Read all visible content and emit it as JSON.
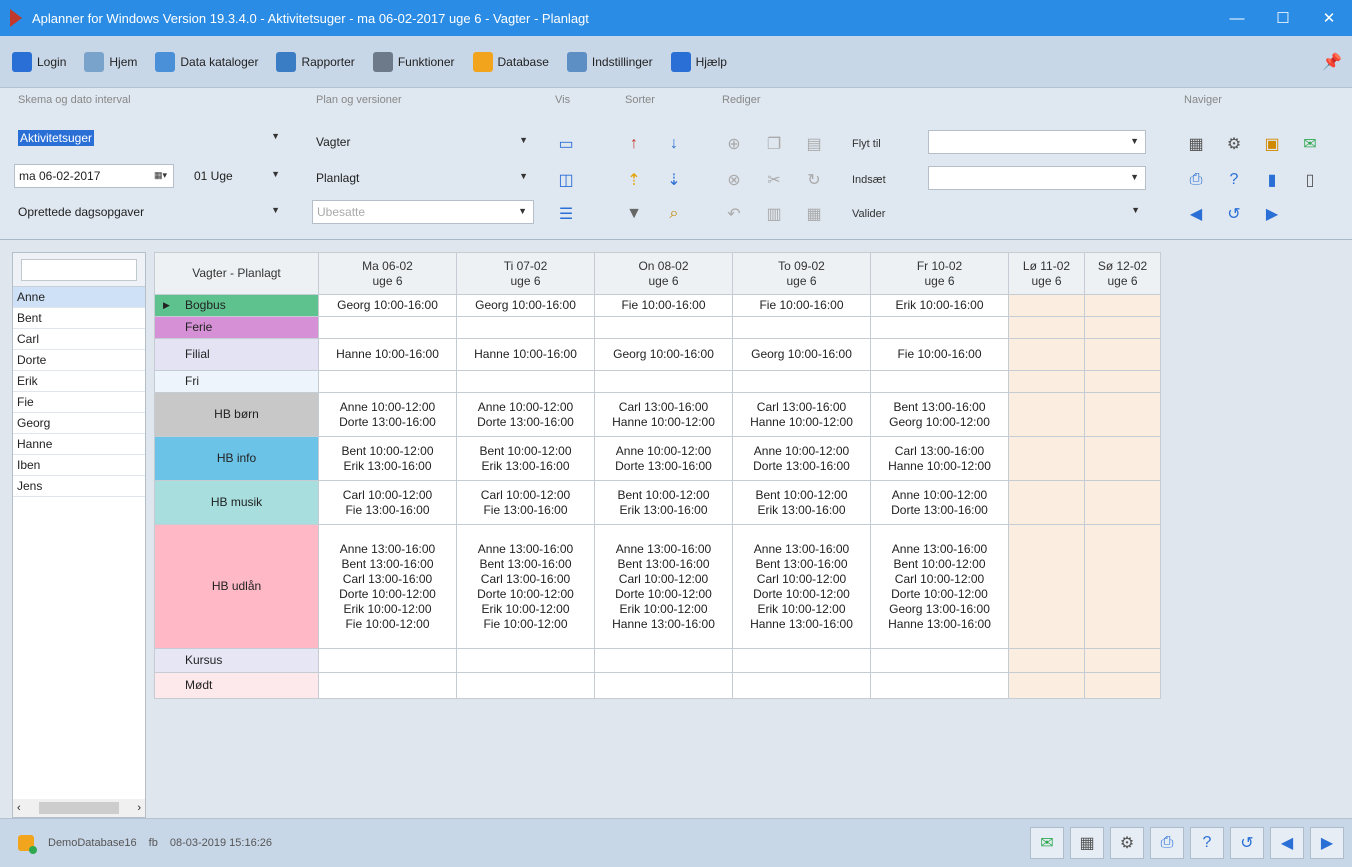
{
  "window": {
    "title": "Aplanner for Windows Version 19.3.4.0 - Aktivitetsuger - ma 06-02-2017 uge 6 - Vagter - Planlagt",
    "minimize": "—",
    "maximize": "☐",
    "close": "✕"
  },
  "menu": {
    "items": [
      {
        "label": "Login",
        "icon": "user-icon",
        "color": "#2a6fd6"
      },
      {
        "label": "Hjem",
        "icon": "home-icon",
        "color": "#7aa3cc"
      },
      {
        "label": "Data kataloger",
        "icon": "catalog-icon",
        "color": "#4a90d9"
      },
      {
        "label": "Rapporter",
        "icon": "report-icon",
        "color": "#3b7dc4"
      },
      {
        "label": "Funktioner",
        "icon": "wrench-icon",
        "color": "#6c7a89"
      },
      {
        "label": "Database",
        "icon": "database-icon",
        "color": "#f2a41c"
      },
      {
        "label": "Indstillinger",
        "icon": "settings-icon",
        "color": "#5d8ec4"
      },
      {
        "label": "Hjælp",
        "icon": "help-icon",
        "color": "#2a6fd6"
      }
    ],
    "pin_icon": "📌"
  },
  "ribbon": {
    "groups": {
      "schema": "Skema og dato interval",
      "plan": "Plan og versioner",
      "vis": "Vis",
      "sort": "Sorter",
      "edit": "Rediger",
      "nav": "Naviger"
    },
    "schema_type": "Aktivitetsuger",
    "date": "ma 06-02-2017",
    "week": "01 Uge",
    "tasks": "Oprettede dagsopgaver",
    "plan": "Vagter",
    "version": "Planlagt",
    "unassigned": "Ubesatte",
    "move_to": "Flyt til",
    "insert": "Indsæt",
    "validate": "Valider"
  },
  "people": [
    "Anne",
    "Bent",
    "Carl",
    "Dorte",
    "Erik",
    "Fie",
    "Georg",
    "Hanne",
    "Iben",
    "Jens"
  ],
  "selected_person": "Anne",
  "grid": {
    "corner": "Vagter - Planlagt",
    "days": [
      {
        "day": "Ma 06-02",
        "week": "uge 6"
      },
      {
        "day": "Ti 07-02",
        "week": "uge 6"
      },
      {
        "day": "On 08-02",
        "week": "uge 6"
      },
      {
        "day": "To 09-02",
        "week": "uge 6"
      },
      {
        "day": "Fr 10-02",
        "week": "uge 6"
      },
      {
        "day": "Lø 11-02",
        "week": "uge 6"
      },
      {
        "day": "Sø 12-02",
        "week": "uge 6"
      }
    ],
    "rows": [
      {
        "name": "Bogbus",
        "color": "#5ec28e",
        "cells": [
          "Georg 10:00-16:00",
          "Georg 10:00-16:00",
          "Fie 10:00-16:00",
          "Fie 10:00-16:00",
          "Erik 10:00-16:00"
        ]
      },
      {
        "name": "Ferie",
        "color": "#d690d6",
        "cells": [
          "",
          "",
          "",
          "",
          ""
        ]
      },
      {
        "name": "Filial",
        "color": "#e3e3f4",
        "cells": [
          "Hanne 10:00-16:00",
          "Hanne 10:00-16:00",
          "Georg 10:00-16:00",
          "Georg 10:00-16:00",
          "Fie 10:00-16:00"
        ]
      },
      {
        "name": "Fri",
        "color": "#eef4fb",
        "cells": [
          "",
          "",
          "",
          "",
          ""
        ]
      },
      {
        "name": "HB børn",
        "color": "#c8c8c8",
        "cells": [
          "Anne 10:00-12:00\nDorte 13:00-16:00",
          "Anne 10:00-12:00\nDorte 13:00-16:00",
          "Carl 13:00-16:00\nHanne 10:00-12:00",
          "Carl 13:00-16:00\nHanne 10:00-12:00",
          "Bent 13:00-16:00\nGeorg 10:00-12:00"
        ]
      },
      {
        "name": "HB info",
        "color": "#6cc3e8",
        "cells": [
          "Bent 10:00-12:00\nErik 13:00-16:00",
          "Bent 10:00-12:00\nErik 13:00-16:00",
          "Anne 10:00-12:00\nDorte 13:00-16:00",
          "Anne 10:00-12:00\nDorte 13:00-16:00",
          "Carl 13:00-16:00\nHanne 10:00-12:00"
        ]
      },
      {
        "name": "HB musik",
        "color": "#a8dede",
        "cells": [
          "Carl 10:00-12:00\nFie 13:00-16:00",
          "Carl 10:00-12:00\nFie 13:00-16:00",
          "Bent 10:00-12:00\nErik 13:00-16:00",
          "Bent 10:00-12:00\nErik 13:00-16:00",
          "Anne 10:00-12:00\nDorte 13:00-16:00"
        ]
      },
      {
        "name": "HB udlån",
        "color": "#ffb9c6",
        "cells": [
          "Anne 13:00-16:00\nBent 13:00-16:00\nCarl 13:00-16:00\nDorte 10:00-12:00\nErik 10:00-12:00\nFie 10:00-12:00",
          "Anne 13:00-16:00\nBent 13:00-16:00\nCarl 13:00-16:00\nDorte 10:00-12:00\nErik 10:00-12:00\nFie 10:00-12:00",
          "Anne 13:00-16:00\nBent 13:00-16:00\nCarl 10:00-12:00\nDorte 10:00-12:00\nErik 10:00-12:00\nHanne 13:00-16:00",
          "Anne 13:00-16:00\nBent 13:00-16:00\nCarl 10:00-12:00\nDorte 10:00-12:00\nErik 10:00-12:00\nHanne 13:00-16:00",
          "Anne 13:00-16:00\nBent 10:00-12:00\nCarl 10:00-12:00\nDorte 10:00-12:00\nGeorg 13:00-16:00\nHanne 13:00-16:00"
        ]
      },
      {
        "name": "Kursus",
        "color": "#e6e6f4",
        "cells": [
          "",
          "",
          "",
          "",
          ""
        ]
      },
      {
        "name": "Mødt",
        "color": "#fde9ec",
        "cells": [
          "",
          "",
          "",
          "",
          ""
        ]
      }
    ]
  },
  "status": {
    "database": "DemoDatabase16",
    "user": "fb",
    "timestamp": "08-03-2019 15:16:26"
  }
}
